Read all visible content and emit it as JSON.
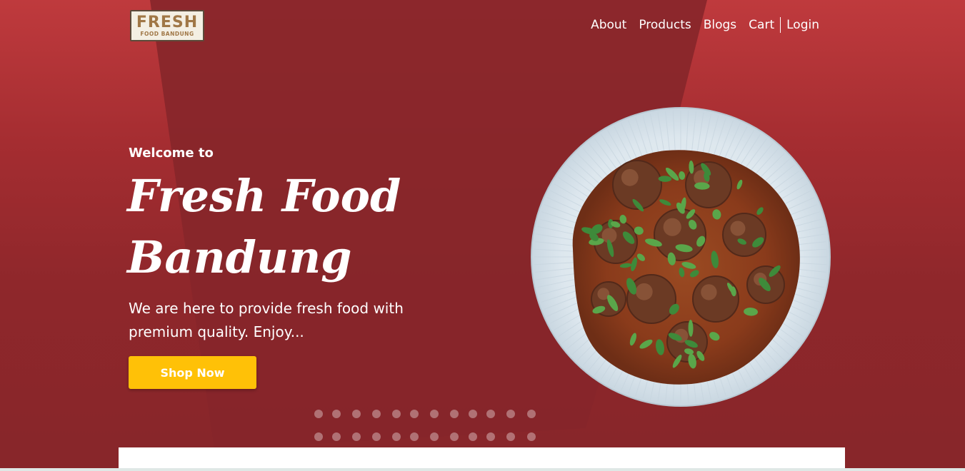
{
  "logo": {
    "main": "FRESH",
    "sub": "FOOD BANDUNG"
  },
  "nav": {
    "items": [
      {
        "label": "About"
      },
      {
        "label": "Products"
      },
      {
        "label": "Blogs"
      },
      {
        "label": "Cart"
      }
    ],
    "login": "Login"
  },
  "hero": {
    "welcome": "Welcome to",
    "title_line1": "Fresh Food",
    "title_line2": "Bandung",
    "description": "We are here to provide fresh food with premium quality. Enjoy...",
    "cta": "Shop Now",
    "image_icon": "meatball-plate-image"
  },
  "colors": {
    "primary_red": "#a52d31",
    "dark_red": "#87262a",
    "accent_yellow": "#ffc107",
    "text_white": "#ffffff"
  }
}
